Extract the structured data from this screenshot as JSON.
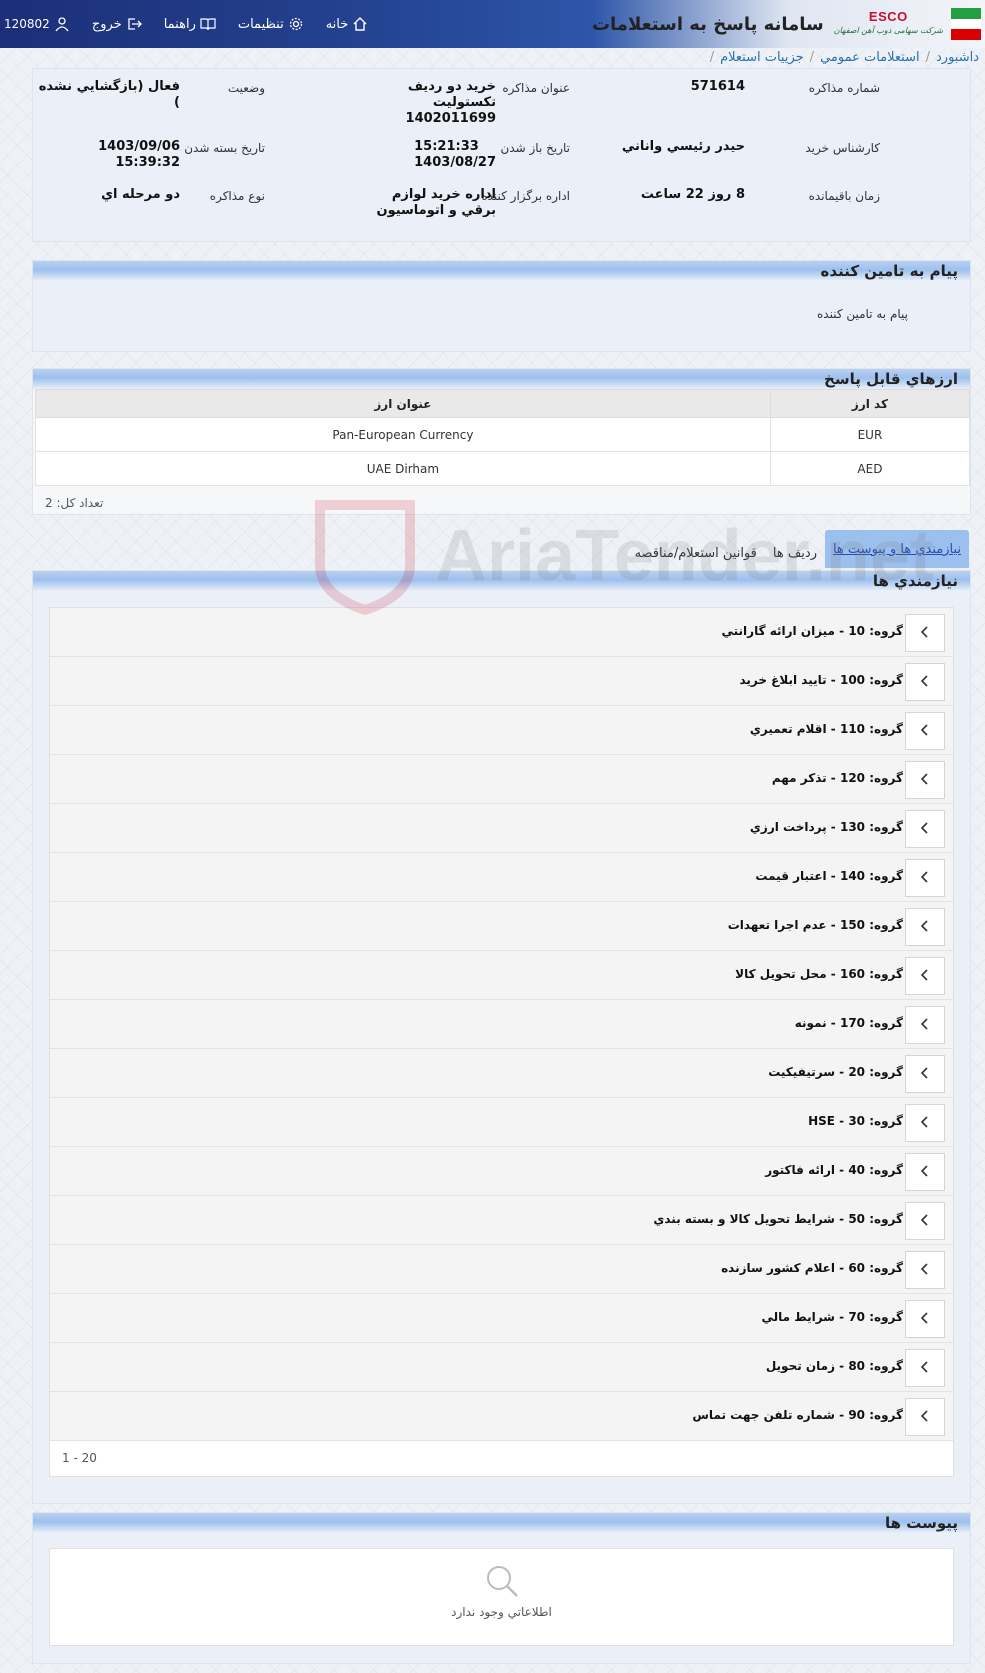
{
  "header": {
    "app_title": "سامانه پاسخ به استعلامات",
    "logo_text": "ESCO",
    "logo_subtext": "شرکت سهامی ذوب آهن اصفهان",
    "nav": {
      "home": "خانه",
      "settings": "تنظیمات",
      "guide": "راهنما",
      "logout": "خروج",
      "user_id": "120802"
    }
  },
  "breadcrumb": [
    "داشبورد",
    "استعلامات عمومي",
    "جزييات استعلام"
  ],
  "info": {
    "negotiation_number_label": "شماره مذاکره",
    "negotiation_number": "571614",
    "negotiation_title_label": "عنوان مذاکره",
    "negotiation_title": "خريد دو رديف تکستوليت 1402011699",
    "status_label": "وضعيت",
    "status": "فعال (بازگشايي نشده )",
    "buyer_expert_label": "کارشناس خريد",
    "buyer_expert": "حيدر رئيسي واناني",
    "open_date_label": "تاريخ باز شدن",
    "open_time": "15:21:33",
    "open_date": "1403/08/27",
    "close_date_label": "تاريخ بسته شدن",
    "close_date": "1403/09/06 15:39:32",
    "remaining_time_label": "زمان باقيمانده",
    "remaining_time": "8 روز 22 ساعت",
    "organizer_label": "اداره برگزار کننده",
    "organizer": "اداره خريد لوازم برقي و اتوماسيون",
    "negotiation_type_label": "نوع مذاکره",
    "negotiation_type": "دو مرحله اي"
  },
  "message": {
    "title": "پيام به تامين کننده",
    "body": "پيام به تامين کننده"
  },
  "currencies": {
    "title": "ارزهاي قابل پاسخ",
    "columns": [
      "کد ارز",
      "عنوان ارز"
    ],
    "rows": [
      {
        "code": "EUR",
        "name": "Pan-European Currency"
      },
      {
        "code": "AED",
        "name": "UAE Dirham"
      }
    ],
    "total": "تعداد کل: 2"
  },
  "tabs": [
    "نيازمندي ها و پيوست ها",
    "رديف ها",
    "قوانين استعلام/مناقصه"
  ],
  "requirements": {
    "title": "نيازمندي ها",
    "groups": [
      "گروه: 10 - ميزان ارائه گارانتي",
      "گروه: 100 - تاييد ابلاغ خريد",
      "گروه: 110 - اقلام تعميري",
      "گروه: 120 - تذکر مهم",
      "گروه: 130 - پرداخت ارزي",
      "گروه: 140 - اعتبار قيمت",
      "گروه: 150 - عدم اجرا تعهدات",
      "گروه: 160 - محل تحويل کالا",
      "گروه: 170 - نمونه",
      "گروه: 20 - سرتيفيکيت",
      "گروه: 30 - HSE",
      "گروه: 40 - ارائه فاکتور",
      "گروه: 50 - شرايط تحويل کالا و بسته بندي",
      "گروه: 60 - اعلام کشور سازنده",
      "گروه: 70 - شرايط مالي",
      "گروه: 80 - زمان تحويل",
      "گروه: 90 - شماره تلفن جهت تماس"
    ],
    "pager": "1 - 20"
  },
  "attachments": {
    "title": "پيوست ها",
    "empty_text": "اطلاعاتي وجود ندارد"
  },
  "watermark": "AriaTender.net",
  "colors": {
    "header_dark": "#1c2f78",
    "panel_head": "#9cc0ee",
    "link": "#2a6fb0",
    "logo_red": "#c8102e"
  }
}
